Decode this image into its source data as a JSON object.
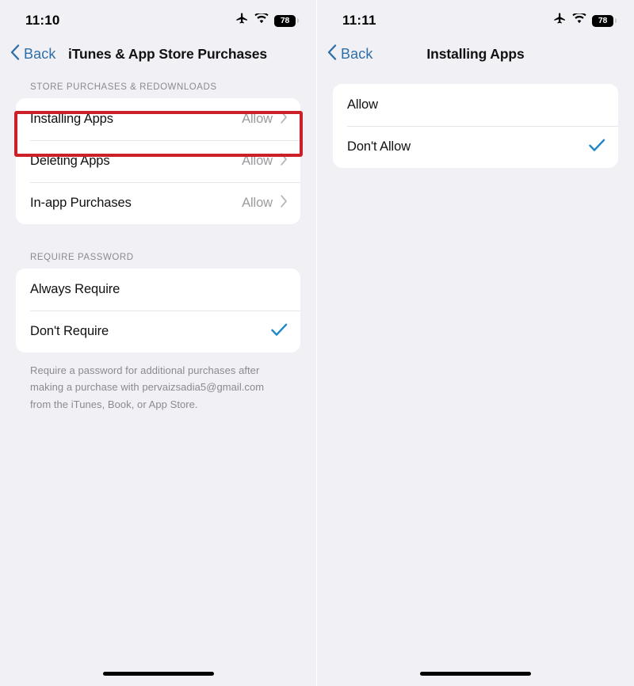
{
  "panels": [
    {
      "status": {
        "time": "11:10",
        "battery": "78",
        "icons": [
          "airplane-icon",
          "wifi-icon",
          "battery-icon"
        ]
      },
      "nav": {
        "back_label": "Back",
        "title": "iTunes & App Store Purchases"
      },
      "section1": {
        "header": "STORE PURCHASES & REDOWNLOADS",
        "rows": [
          {
            "label": "Installing Apps",
            "value": "Allow"
          },
          {
            "label": "Deleting Apps",
            "value": "Allow"
          },
          {
            "label": "In-app Purchases",
            "value": "Allow"
          }
        ]
      },
      "section2": {
        "header": "REQUIRE PASSWORD",
        "rows": [
          {
            "label": "Always Require",
            "checked": false
          },
          {
            "label": "Don't Require",
            "checked": true
          }
        ],
        "footnote": "Require a password for additional purchases after making a purchase with pervaizsadia5@gmail.com from the iTunes, Book, or App Store."
      },
      "highlight": {
        "target": "Installing Apps",
        "color": "#cc2028"
      }
    },
    {
      "status": {
        "time": "11:11",
        "battery": "78",
        "icons": [
          "airplane-icon",
          "wifi-icon",
          "battery-icon"
        ]
      },
      "nav": {
        "back_label": "Back",
        "title": "Installing Apps"
      },
      "options": [
        {
          "label": "Allow",
          "checked": false
        },
        {
          "label": "Don't Allow",
          "checked": true
        }
      ]
    }
  ],
  "theme": {
    "background": "#f1f1f5",
    "card": "#ffffff",
    "accent_blue": "#2e6fa8",
    "check_blue": "#1d86c8",
    "secondary_text": "#8a8a8f",
    "highlight_red": "#cc2028"
  }
}
